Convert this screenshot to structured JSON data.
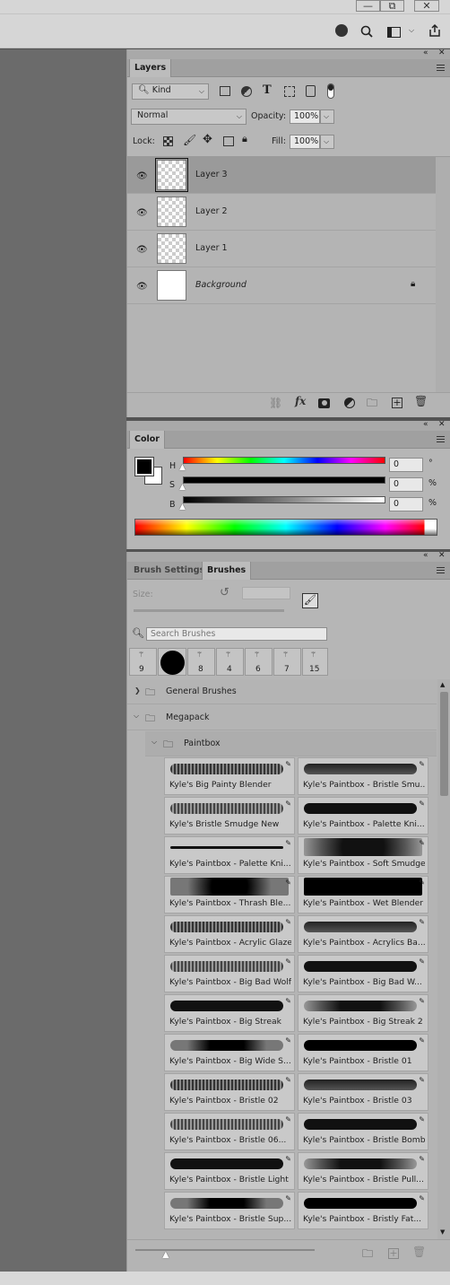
{
  "window": {
    "minimize": "—",
    "restore": "⧉",
    "close": "✕"
  },
  "layers_panel": {
    "tab": "Layers",
    "filter_kind": "Kind",
    "blend_mode": "Normal",
    "opacity_label": "Opacity:",
    "opacity_value": "100%",
    "lock_label": "Lock:",
    "fill_label": "Fill:",
    "fill_value": "100%",
    "layers": [
      {
        "name": "Layer 3",
        "selected": true
      },
      {
        "name": "Layer 2"
      },
      {
        "name": "Layer 1"
      },
      {
        "name": "Background",
        "locked": true
      }
    ],
    "footer_fx": "fx"
  },
  "color_panel": {
    "tab": "Color",
    "h_label": "H",
    "s_label": "S",
    "b_label": "B",
    "h_value": "0",
    "s_value": "0",
    "b_value": "0",
    "h_unit": "°",
    "s_unit": "%",
    "b_unit": "%",
    "foreground": "#000000",
    "background": "#ffffff"
  },
  "brushes_panel": {
    "tabs": [
      "Brush Settings",
      "Brushes"
    ],
    "size_label": "Size:",
    "search_placeholder": "Search Brushes",
    "presets": [
      "9",
      "",
      "8",
      "4",
      "6",
      "7",
      "15"
    ],
    "groups": [
      "General Brushes",
      "Megapack",
      "Paintbox"
    ],
    "brushes": [
      "Kyle's Big Painty Blender",
      "Kyle's Paintbox - Bristle Smu...",
      "Kyle's Bristle Smudge New",
      "Kyle's Paintbox - Palette Kni...",
      "Kyle's Paintbox - Palette Kni...",
      "Kyle's Paintbox - Soft Smudge",
      "Kyle's Paintbox - Thrash Ble...",
      "Kyle's Paintbox - Wet Blender",
      "Kyle's Paintbox - Acrylic Glaze",
      "Kyle's Paintbox - Acrylics Ba...",
      "Kyle's Paintbox - Big Bad Wolf",
      "Kyle's Paintbox - Big Bad W...",
      "Kyle's Paintbox - Big Streak",
      "Kyle's Paintbox - Big Streak 2",
      "Kyle's Paintbox - Big Wide S...",
      "Kyle's Paintbox - Bristle 01",
      "Kyle's Paintbox - Bristle 02",
      "Kyle's Paintbox - Bristle 03",
      "Kyle's Paintbox - Bristle 06...",
      "Kyle's Paintbox - Bristle Bomb",
      "Kyle's Paintbox - Bristle Light",
      "Kyle's Paintbox - Bristle Pull...",
      "Kyle's Paintbox - Bristle Sup...",
      "Kyle's Paintbox - Bristly Fat..."
    ]
  }
}
